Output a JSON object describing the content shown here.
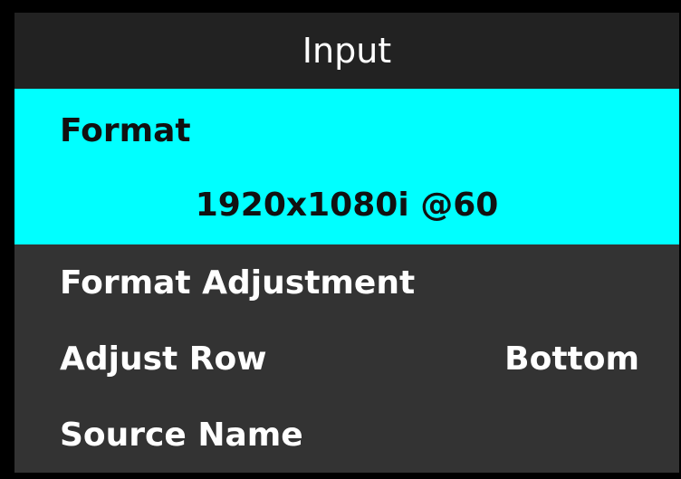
{
  "menu": {
    "title": "Input",
    "selected": {
      "label": "Format",
      "value": "1920x1080i @60"
    },
    "items": [
      {
        "label": "Format Adjustment",
        "value": ""
      },
      {
        "label": "Adjust Row",
        "value": "Bottom"
      },
      {
        "label": "Source Name",
        "value": ""
      }
    ]
  },
  "colors": {
    "background": "#000000",
    "panel": "#333333",
    "title_bar": "#222222",
    "highlight": "#00ffff",
    "text": "#ffffff",
    "highlight_text": "#111111"
  }
}
